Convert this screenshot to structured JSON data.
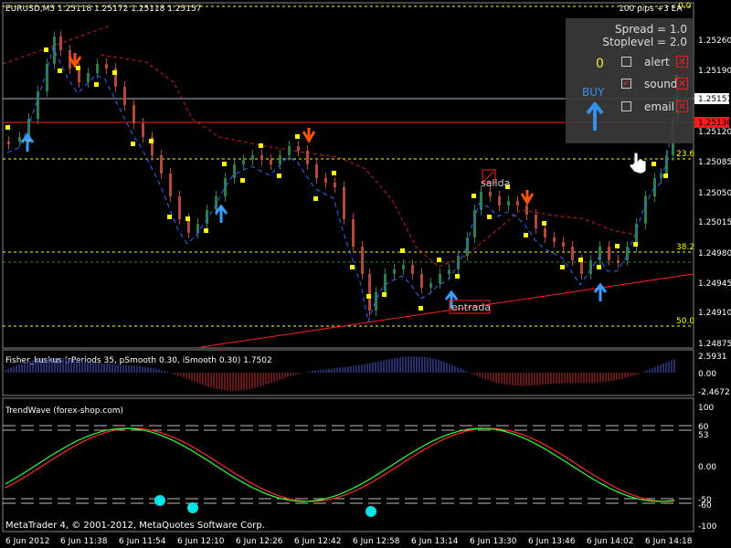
{
  "main_chart": {
    "title": "EURUSD,M5  1.25118 1.25172 1.25118 1.25157",
    "ea_title": "100 pips +3 EA",
    "price_ticks": [
      "1.25260",
      "1.25190",
      "1.25120",
      "1.25085",
      "1.25050",
      "1.25015",
      "1.24980",
      "1.24945",
      "1.24910",
      "1.24875"
    ],
    "current_price": "1.25157",
    "red_line_price": "1.25130",
    "fib_labels": [
      "0.0",
      "23.6",
      "38.2",
      "50.0"
    ],
    "tags": {
      "salida": "salida",
      "entrada": "entrada"
    },
    "colors": {
      "bull": "#2e7d4f",
      "bear": "#b04a3a",
      "dots": "#ffff00",
      "fib": "#ffff00",
      "ma": "#2a6cff"
    }
  },
  "ea_panel": {
    "spread": "Spread = 1.0",
    "stoplevel": "Stoplevel = 2.0",
    "count": "0",
    "buy_label": "BUY",
    "alert_label": "alert",
    "sound_label": "sound",
    "email_label": "email"
  },
  "fisher": {
    "title": "Fisher_kuskus (rPeriods 35, pSmooth 0.30, iSmooth 0.30)   1.7502",
    "ticks": [
      "2.5931",
      "0.00",
      "-2.4672"
    ]
  },
  "trendwave": {
    "title": "TrendWave (forex-shop.com)",
    "ticks": [
      "100",
      "60",
      "53",
      "0.00",
      "-50",
      "-60",
      "-100"
    ]
  },
  "time_axis": [
    "6 Jun 2012",
    "6 Jun 11:38",
    "6 Jun 11:54",
    "6 Jun 12:10",
    "6 Jun 12:26",
    "6 Jun 12:42",
    "6 Jun 12:58",
    "6 Jun 13:14",
    "6 Jun 13:30",
    "6 Jun 13:46",
    "6 Jun 14:02",
    "6 Jun 14:18"
  ],
  "copyright": "MetaTrader 4, © 2001-2012, MetaQuotes Software Corp."
}
